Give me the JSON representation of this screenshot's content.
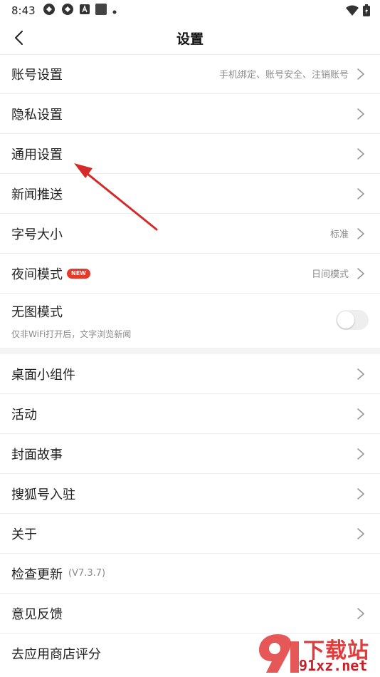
{
  "statusbar": {
    "time": "8:43"
  },
  "navbar": {
    "title": "设置"
  },
  "rows": {
    "account": {
      "label": "账号设置",
      "hint": "手机绑定、账号安全、注销账号"
    },
    "privacy": {
      "label": "隐私设置"
    },
    "general": {
      "label": "通用设置"
    },
    "news_push": {
      "label": "新闻推送"
    },
    "font_size": {
      "label": "字号大小",
      "hint": "标准"
    },
    "night_mode": {
      "label": "夜间模式",
      "badge": "NEW",
      "hint": "日间模式"
    },
    "no_image": {
      "label": "无图模式",
      "sub": "仅非WiFi打开后，文字浏览新闻",
      "enabled": false
    },
    "widget": {
      "label": "桌面小组件"
    },
    "activity": {
      "label": "活动"
    },
    "cover_story": {
      "label": "封面故事"
    },
    "sohu_account": {
      "label": "搜狐号入驻"
    },
    "about": {
      "label": "关于"
    },
    "check_update": {
      "label": "检查更新",
      "version": "(V7.3.7)"
    },
    "feedback": {
      "label": "意见反馈"
    },
    "rate": {
      "label": "去应用商店评分"
    }
  },
  "watermark": {
    "text": "下载站",
    "url": "91xz.net"
  },
  "colors": {
    "accent_red": "#e5392a",
    "divider": "#eeeeee",
    "hint_gray": "#8a8a8a",
    "toggle_off": "#eeeeee"
  }
}
